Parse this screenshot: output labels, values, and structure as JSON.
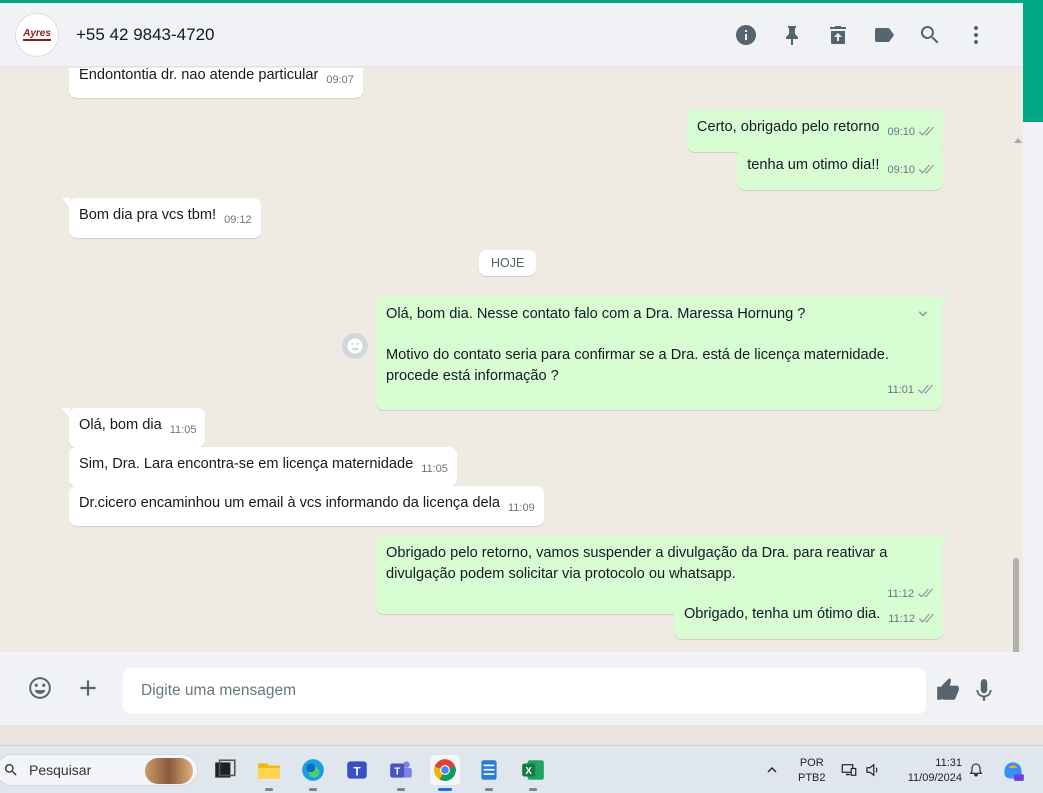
{
  "header": {
    "avatar_text": "Ayres",
    "contact_name": "+55 42 9843-4720",
    "actions": [
      "info-icon",
      "pin-icon",
      "archive-icon",
      "label-icon",
      "search-icon",
      "menu-icon"
    ]
  },
  "messages": [
    {
      "dir": "in",
      "text": "Endontontia dr. nao atende particular",
      "time": "09:07"
    },
    {
      "dir": "out",
      "text": "Certo, obrigado pelo retorno",
      "time": "09:10"
    },
    {
      "dir": "out",
      "text": "tenha um otimo dia!!",
      "time": "09:10"
    },
    {
      "dir": "in",
      "text": "Bom dia pra vcs tbm!",
      "time": "09:12"
    },
    {
      "dir": "out",
      "text_line1": "Olá, bom dia. Nesse contato falo com a Dra. Maressa Hornung ?",
      "text_line2": "Motivo do contato seria para confirmar se a Dra. está de licença maternidade.",
      "text_line3": "procede está informação ?",
      "time": "11:01"
    },
    {
      "dir": "in",
      "text": "Olá, bom dia",
      "time": "11:05"
    },
    {
      "dir": "in",
      "text": "Sim, Dra. Lara  encontra-se em licença maternidade",
      "time": "11:05"
    },
    {
      "dir": "in",
      "text": "Dr.cicero encaminhou um email à vcs informando da licença dela",
      "time": "11:09"
    },
    {
      "dir": "out",
      "text_line1": "Obrigado pelo retorno, vamos suspender a divulgação da Dra. para reativar a",
      "text_line2": "divulgação podem solicitar via protocolo ou whatsapp.",
      "time": "11:12"
    },
    {
      "dir": "out",
      "text": "Obrigado, tenha um ótimo dia.",
      "time": "11:12"
    }
  ],
  "date_divider": "HOJE",
  "composer": {
    "placeholder": "Digite uma mensagem"
  },
  "taskbar": {
    "search_label": "Pesquisar",
    "language": "POR",
    "keyboard": "PTB2",
    "time": "11:31",
    "date": "11/09/2024"
  },
  "colors": {
    "accent": "#00a884",
    "outgoing_bubble": "#d9fdd3",
    "incoming_bubble": "#ffffff",
    "chat_background": "#efeae2"
  }
}
